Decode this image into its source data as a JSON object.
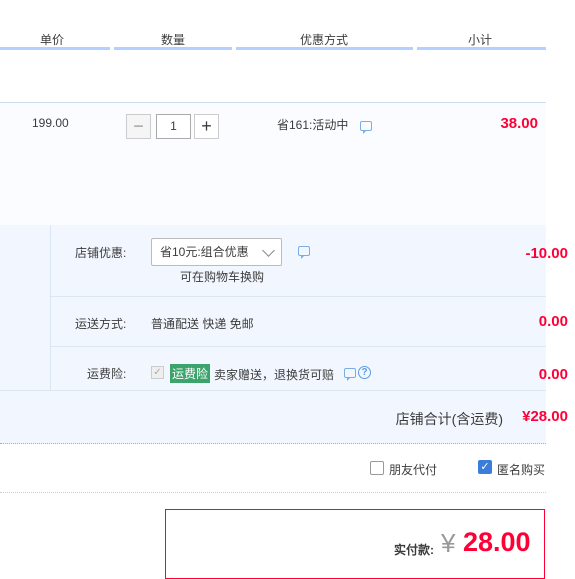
{
  "columns": {
    "unit_price": "单价",
    "quantity": "数量",
    "discount": "优惠方式",
    "subtotal": "小计"
  },
  "item": {
    "unit_price": "199.00",
    "qty_minus": "−",
    "quantity": "1",
    "qty_plus": "+",
    "promotion": "省161:活动中",
    "subtotal": "38.00"
  },
  "shop": {
    "discount_label": "店铺优惠:",
    "discount_select": "省10元:组合优惠",
    "discount_hint": "可在购物车换购",
    "discount_amount": "-10.00",
    "shipping_label": "运送方式:",
    "shipping_method": "普通配送 快递 免邮",
    "shipping_amount": "0.00",
    "insurance_label": "运费险:",
    "insurance_tag": "运费险",
    "insurance_desc": "卖家赠送，退换货可赔",
    "insurance_amount": "0.00",
    "total_label": "店铺合计(含运费)",
    "total_value": "¥28.00"
  },
  "options": {
    "friend_pay": {
      "label": "朋友代付",
      "checked": false
    },
    "anonymous": {
      "label": "匿名购买",
      "checked": true
    }
  },
  "payment": {
    "label": "实付款:",
    "currency": "¥",
    "amount": "28.00"
  },
  "colors": {
    "accent": "#ff0036",
    "header_line": "#b2d1ff",
    "shop_bg": "#f2f7ff",
    "check_blue": "#3b7ddb",
    "tag_green": "#3ca36c"
  }
}
